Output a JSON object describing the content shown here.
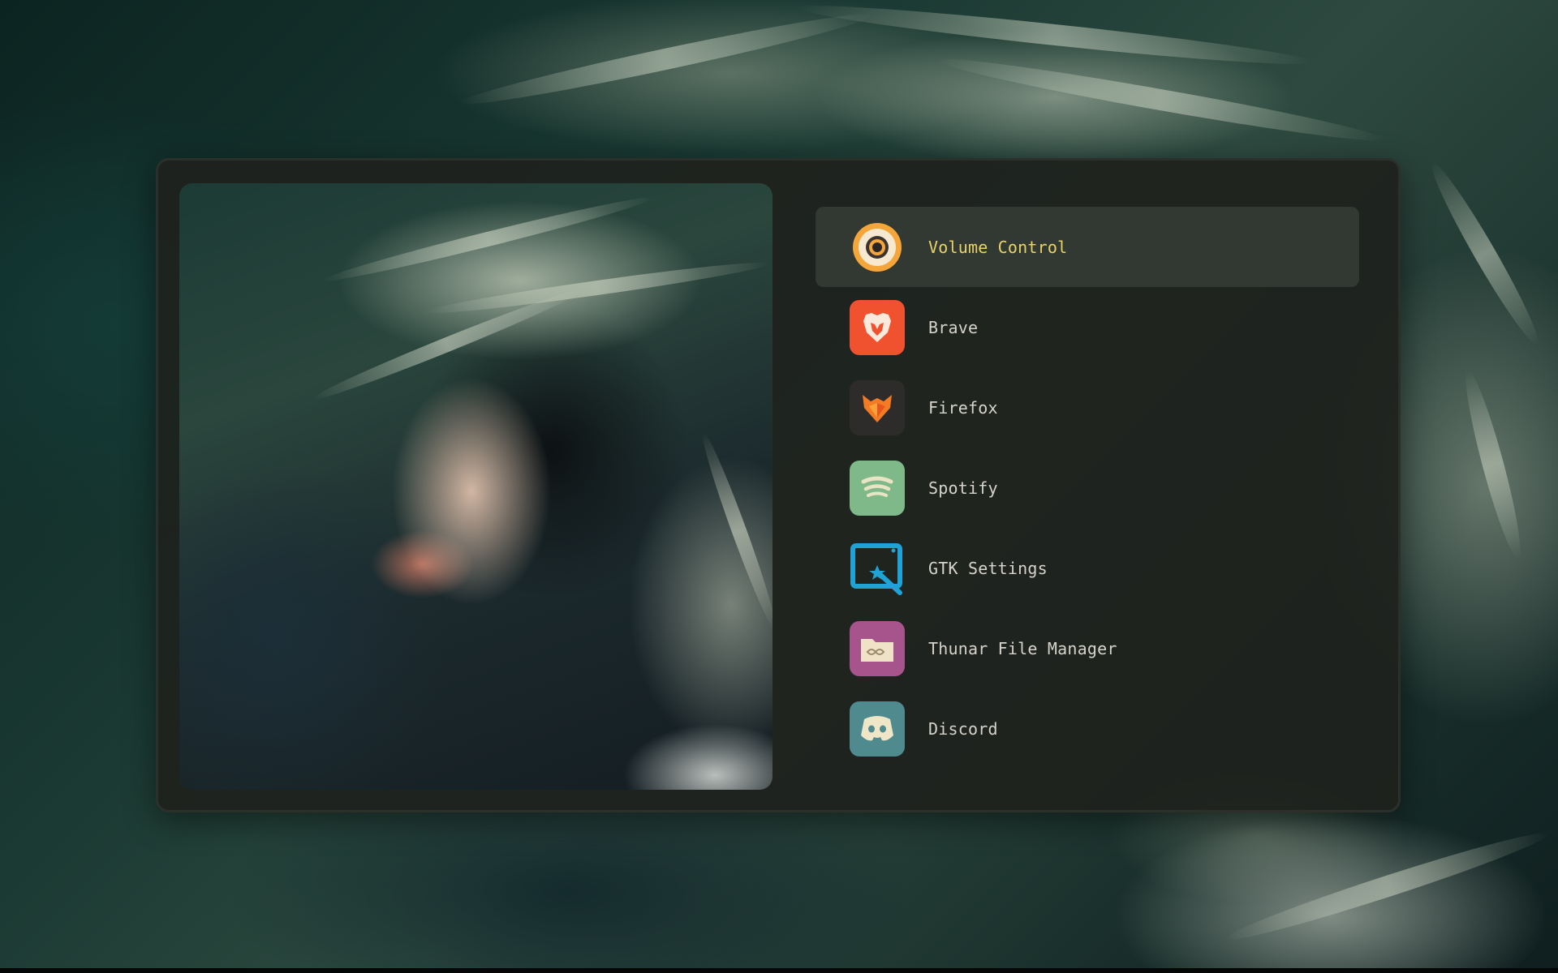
{
  "launcher": {
    "selected_index": 0,
    "items": [
      {
        "label": "Volume Control",
        "icon": "volume-control-icon"
      },
      {
        "label": "Brave",
        "icon": "brave-icon"
      },
      {
        "label": "Firefox",
        "icon": "firefox-icon"
      },
      {
        "label": "Spotify",
        "icon": "spotify-icon"
      },
      {
        "label": "GTK Settings",
        "icon": "gtk-settings-icon"
      },
      {
        "label": "Thunar File Manager",
        "icon": "thunar-icon"
      },
      {
        "label": "Discord",
        "icon": "discord-icon"
      }
    ]
  },
  "theme": {
    "selected_text": "#e8d36a",
    "text": "#d6d3cb",
    "panel_bg": "#1e211d",
    "selected_bg": "#3a4039"
  }
}
